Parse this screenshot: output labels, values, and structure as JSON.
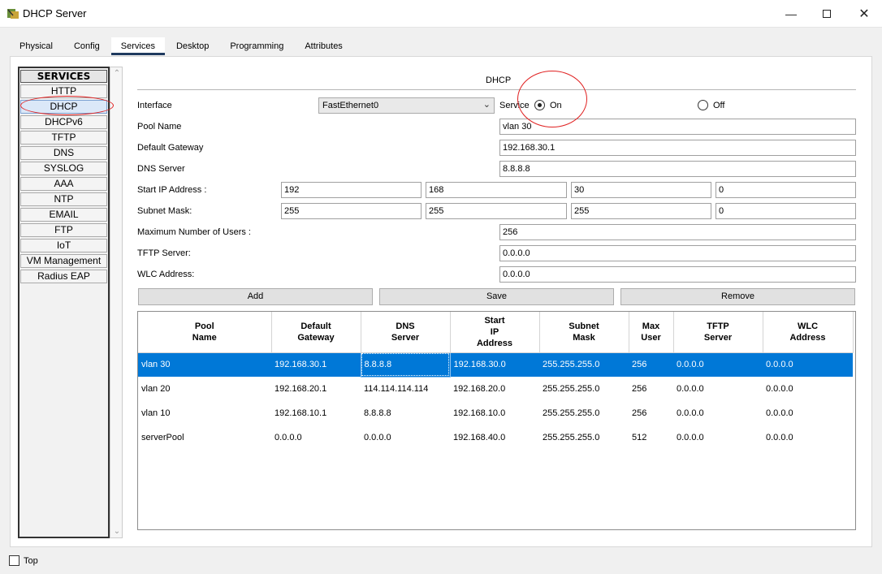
{
  "window": {
    "title": "DHCP Server"
  },
  "tabs": [
    "Physical",
    "Config",
    "Services",
    "Desktop",
    "Programming",
    "Attributes"
  ],
  "sidebar": {
    "header": "SERVICES",
    "items": [
      "HTTP",
      "DHCP",
      "DHCPv6",
      "TFTP",
      "DNS",
      "SYSLOG",
      "AAA",
      "NTP",
      "EMAIL",
      "FTP",
      "IoT",
      "VM Management",
      "Radius EAP"
    ],
    "selected": "DHCP"
  },
  "form": {
    "title": "DHCP",
    "interface_label": "Interface",
    "interface_value": "FastEthernet0",
    "service_label": "Service",
    "on_label": "On",
    "off_label": "Off",
    "service_state": "On",
    "pool_name_label": "Pool Name",
    "pool_name": "vlan 30",
    "default_gateway_label": "Default Gateway",
    "default_gateway": "192.168.30.1",
    "dns_server_label": "DNS Server",
    "dns_server": "8.8.8.8",
    "start_ip_label": "Start IP Address :",
    "start_ip": [
      "192",
      "168",
      "30",
      "0"
    ],
    "subnet_mask_label": "Subnet Mask:",
    "subnet_mask": [
      "255",
      "255",
      "255",
      "0"
    ],
    "max_users_label": "Maximum Number of Users :",
    "max_users": "256",
    "tftp_label": "TFTP Server:",
    "tftp": "0.0.0.0",
    "wlc_label": "WLC Address:",
    "wlc": "0.0.0.0"
  },
  "buttons": {
    "add": "Add",
    "save": "Save",
    "remove": "Remove"
  },
  "table": {
    "headers": [
      "Pool\nName",
      "Default\nGateway",
      "DNS\nServer",
      "Start\nIP\nAddress",
      "Subnet\nMask",
      "Max\nUser",
      "TFTP\nServer",
      "WLC\nAddress"
    ],
    "rows": [
      [
        "vlan 30",
        "192.168.30.1",
        "8.8.8.8",
        "192.168.30.0",
        "255.255.255.0",
        "256",
        "0.0.0.0",
        "0.0.0.0"
      ],
      [
        "vlan 20",
        "192.168.20.1",
        "114.114.114.114",
        "192.168.20.0",
        "255.255.255.0",
        "256",
        "0.0.0.0",
        "0.0.0.0"
      ],
      [
        "vlan 10",
        "192.168.10.1",
        "8.8.8.8",
        "192.168.10.0",
        "255.255.255.0",
        "256",
        "0.0.0.0",
        "0.0.0.0"
      ],
      [
        "serverPool",
        "0.0.0.0",
        "0.0.0.0",
        "192.168.40.0",
        "255.255.255.0",
        "512",
        "0.0.0.0",
        "0.0.0.0"
      ]
    ],
    "selected_row": 0
  },
  "footer": {
    "top_label": "Top"
  },
  "colors": {
    "selection": "#0078d7",
    "annotation": "#e02020",
    "tab_underline": "#1f3a5f"
  }
}
